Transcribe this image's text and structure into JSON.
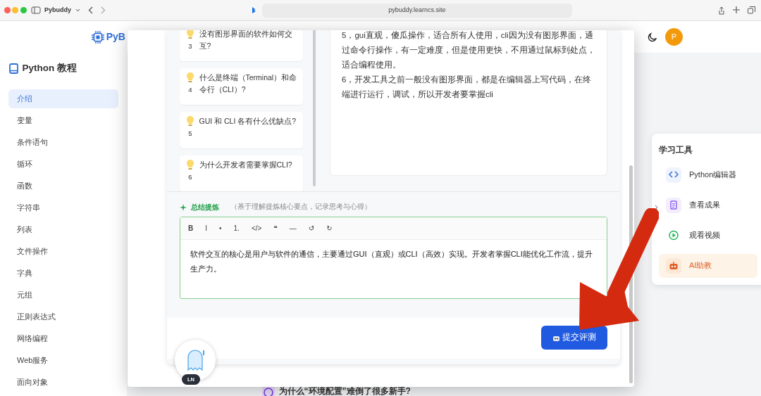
{
  "browser": {
    "tab_title": "Pybuddy",
    "url": "pybuddy.learncs.site"
  },
  "header": {
    "logo_text": "PyB",
    "avatar": "P"
  },
  "sidebar": {
    "title": "Python 教程",
    "items": [
      {
        "label": "介绍",
        "selected": true
      },
      {
        "label": "变量",
        "selected": false
      },
      {
        "label": "条件语句",
        "selected": false
      },
      {
        "label": "循环",
        "selected": false
      },
      {
        "label": "函数",
        "selected": false
      },
      {
        "label": "字符串",
        "selected": false
      },
      {
        "label": "列表",
        "selected": false
      },
      {
        "label": "文件操作",
        "selected": false
      },
      {
        "label": "字典",
        "selected": false
      },
      {
        "label": "元组",
        "selected": false
      },
      {
        "label": "正则表达式",
        "selected": false
      },
      {
        "label": "网络编程",
        "selected": false
      },
      {
        "label": "Web服务",
        "selected": false
      },
      {
        "label": "面向对象",
        "selected": false
      }
    ]
  },
  "background_question": "为什么“环境配置”难倒了很多新手?",
  "tools_panel": {
    "title": "学习工具",
    "items": [
      {
        "label": "Python编辑器",
        "kind": "code",
        "selected": false
      },
      {
        "label": "查看成果",
        "kind": "document",
        "selected": false
      },
      {
        "label": "观看视频",
        "kind": "video",
        "selected": false
      },
      {
        "label": "AI助教",
        "kind": "robot",
        "selected": true
      }
    ]
  },
  "dialog": {
    "questions": [
      {
        "number": "3",
        "text": "没有图形界面的软件如何交互?"
      },
      {
        "number": "4",
        "text": "什么是终端（Terminal）和命令行（CLI）?"
      },
      {
        "number": "5",
        "text": "GUI 和 CLI 各有什么优缺点?"
      },
      {
        "number": "6",
        "text": "为什么开发者需要掌握CLI?"
      }
    ],
    "answer_lines": [
      "5，gui直观，傻瓜操作，适合所有人使用，cli因为没有图形界面，通过命令行操作，有一定难度，但是使用更快，不用通过鼠标到处点，适合编程使用。",
      "6，开发工具之前一般没有图形界面，都是在编辑器上写代码，在终端进行运行，调试，所以开发者要掌握cli"
    ],
    "summary": {
      "label": "总结提炼",
      "hint": "（基于理解提炼核心要点，记录思考与心得）",
      "toolbar": [
        "B",
        "I",
        "•",
        "1.",
        "</>",
        "❝",
        "—",
        "↺",
        "↻"
      ],
      "text": "软件交互的核心是用户与软件的通信，主要通过GUI（直观）或CLI（高效）实现。开发者掌握CLI能优化工作流，提升生产力。"
    },
    "submit": "提交评测",
    "mascot_badge": "LN"
  }
}
